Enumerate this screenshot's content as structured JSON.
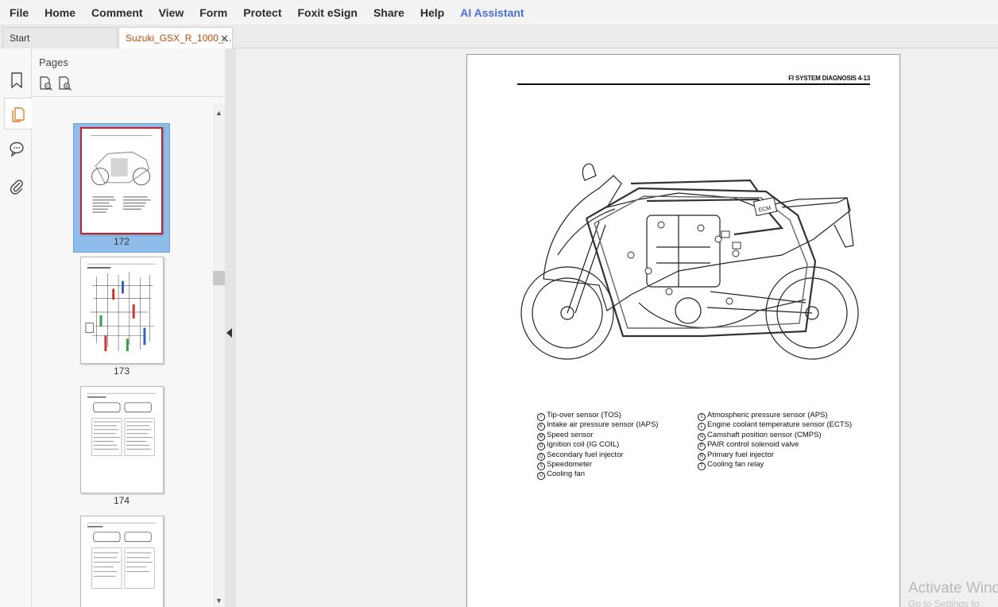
{
  "menu": {
    "items": [
      "File",
      "Home",
      "Comment",
      "View",
      "Form",
      "Protect",
      "Foxit eSign",
      "Share",
      "Help",
      "AI Assistant"
    ]
  },
  "tabs": {
    "start": "Start",
    "active": "Suzuki_GSX_R_1000_...",
    "close_glyph": "✕"
  },
  "pages_panel": {
    "title": "Pages",
    "thumbnails": [
      {
        "label": "172",
        "selected": true
      },
      {
        "label": "173",
        "selected": false
      },
      {
        "label": "174",
        "selected": false
      },
      {
        "label": "",
        "selected": false
      }
    ]
  },
  "document": {
    "header": "FI SYSTEM DIAGNOSIS    4-13",
    "legend_left": [
      {
        "mark": "I",
        "text": "Tip-over sensor (TOS)"
      },
      {
        "mark": "K",
        "text": "Intake air pressure sensor (IAPS)"
      },
      {
        "mark": "M",
        "text": "Speed sensor"
      },
      {
        "mark": "O",
        "text": "Ignition coil (IG COIL)"
      },
      {
        "mark": "Q",
        "text": "Secondary fuel injector"
      },
      {
        "mark": "S",
        "text": "Speedometer"
      },
      {
        "mark": "U",
        "text": "Cooling fan"
      }
    ],
    "legend_right": [
      {
        "mark": "J",
        "text": "Atmospheric pressure sensor (APS)"
      },
      {
        "mark": "L",
        "text": "Engine coolant temperature sensor (ECTS)"
      },
      {
        "mark": "N",
        "text": "Camshaft position sensor (CMPS)"
      },
      {
        "mark": "P",
        "text": "PAIR control solenoid valve"
      },
      {
        "mark": "R",
        "text": "Primary fuel injector"
      },
      {
        "mark": "T",
        "text": "Cooling fan relay"
      }
    ],
    "figure_label": "ECM"
  },
  "watermark": {
    "line1": "Activate Wind",
    "line2": "Go to Settings to"
  }
}
